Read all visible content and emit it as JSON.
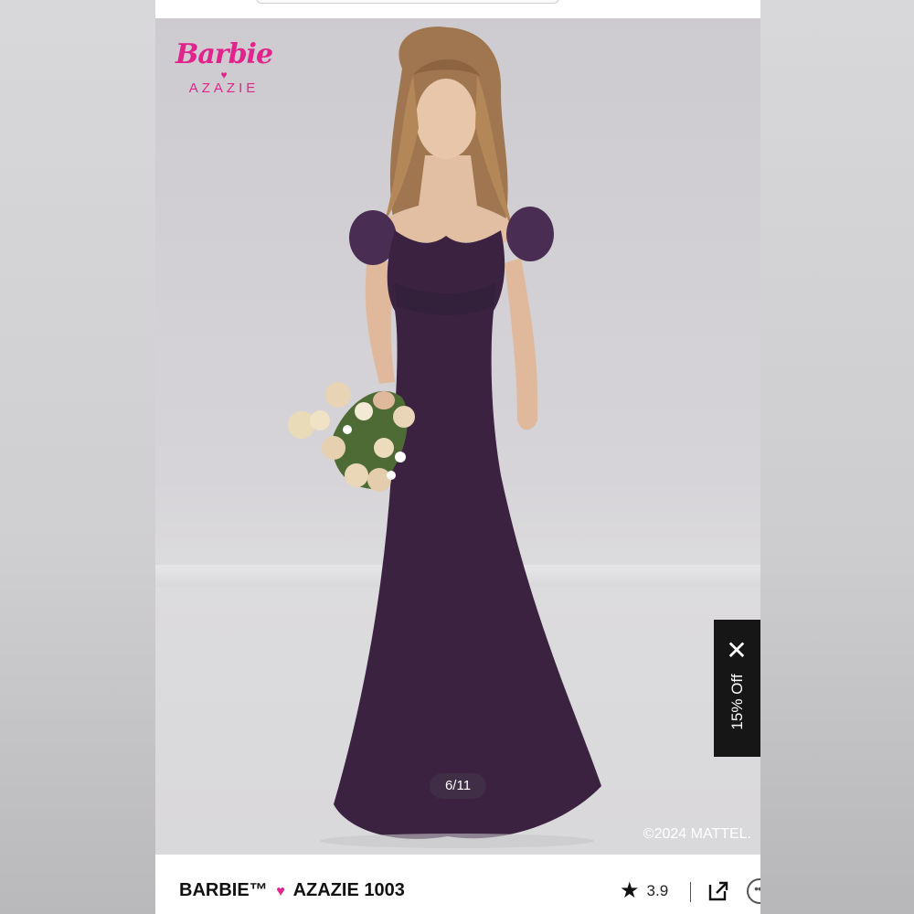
{
  "brand": {
    "logo_top": "Barbie",
    "logo_bottom": "AZAZIE"
  },
  "gallery": {
    "counter": "6/11",
    "copyright": "©2024 MATTEL."
  },
  "promo": {
    "close_icon": "close-icon",
    "label": "15% Off"
  },
  "product": {
    "brand_left": "BARBIE™",
    "heart": "♥",
    "brand_right": "AZAZIE 1003",
    "rating": "3.9",
    "star_icon": "star-icon",
    "share_icon": "external-link-icon",
    "more_icon": "more-icon"
  },
  "colors": {
    "brand_pink": "#e2238d",
    "dress": "#3a2240",
    "promo_bg": "#161616"
  }
}
